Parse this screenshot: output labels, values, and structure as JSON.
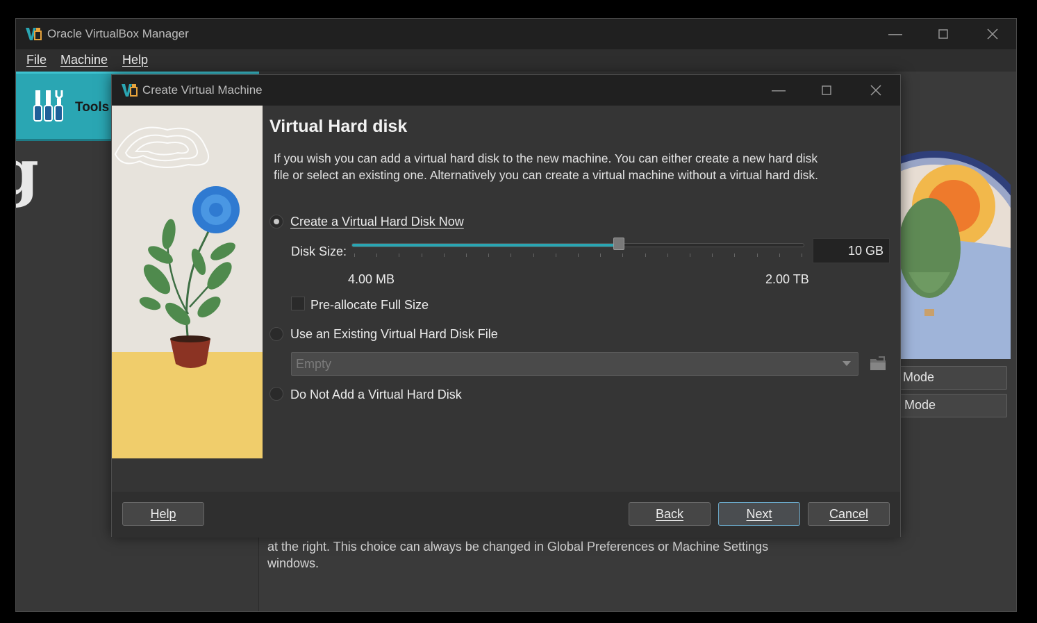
{
  "main_window": {
    "title": "Oracle VirtualBox Manager",
    "menu": [
      "File",
      "Machine",
      "Help"
    ],
    "tools_label": "Tools",
    "background_text": "at the right. This choice can always be changed in Global Preferences or Machine Settings windows.",
    "mode_buttons": [
      "Mode",
      "t Mode"
    ]
  },
  "dialog": {
    "title": "Create Virtual Machine",
    "heading": "Virtual Hard disk",
    "description": "If you wish you can add a virtual hard disk to the new machine. You can either create a new hard disk file or select an existing one. Alternatively you can create a virtual machine without a virtual hard disk.",
    "options": {
      "create_now": "Create a Virtual Hard Disk Now",
      "use_existing": "Use an Existing Virtual Hard Disk File",
      "do_not_add": "Do Not Add a Virtual Hard Disk"
    },
    "selected_option": "create_now",
    "disk_size_label": "Disk Size:",
    "disk_size_value": "10 GB",
    "slider": {
      "min_label": "4.00 MB",
      "max_label": "2.00 TB",
      "position_fraction": 0.59
    },
    "preallocate_label": "Pre-allocate Full Size",
    "preallocate_checked": false,
    "existing_file_placeholder": "Empty",
    "buttons": {
      "help": "Help",
      "back": "Back",
      "next": "Next",
      "cancel": "Cancel"
    }
  },
  "colors": {
    "accent": "#2aa6b3",
    "background": "#353535",
    "titlebar": "#202020"
  }
}
